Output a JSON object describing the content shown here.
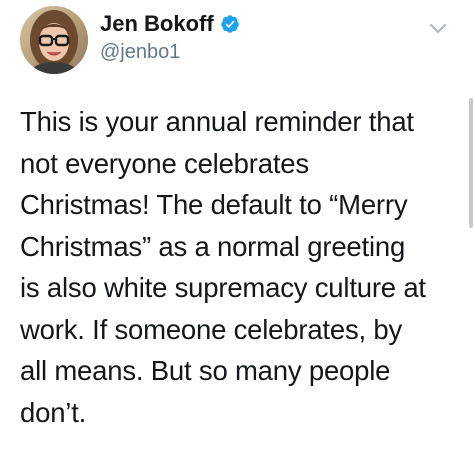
{
  "tweet": {
    "author": {
      "display_name": "Jen Bokoff",
      "handle": "@jenbo1",
      "verified": true,
      "avatar_icon": "profile-photo"
    },
    "more_icon": "chevron-down-icon",
    "body_lines": [
      "This is your annual reminder that",
      "not everyone celebrates",
      "Christmas! The default to “Merry",
      "Christmas” as a normal greeting",
      "is also white supremacy culture at",
      "work. If someone celebrates, by",
      "all means. But so many people",
      "don’t."
    ]
  },
  "colors": {
    "verified_badge": "#1da1f2",
    "handle_text": "#657786",
    "body_text": "#14171a"
  }
}
